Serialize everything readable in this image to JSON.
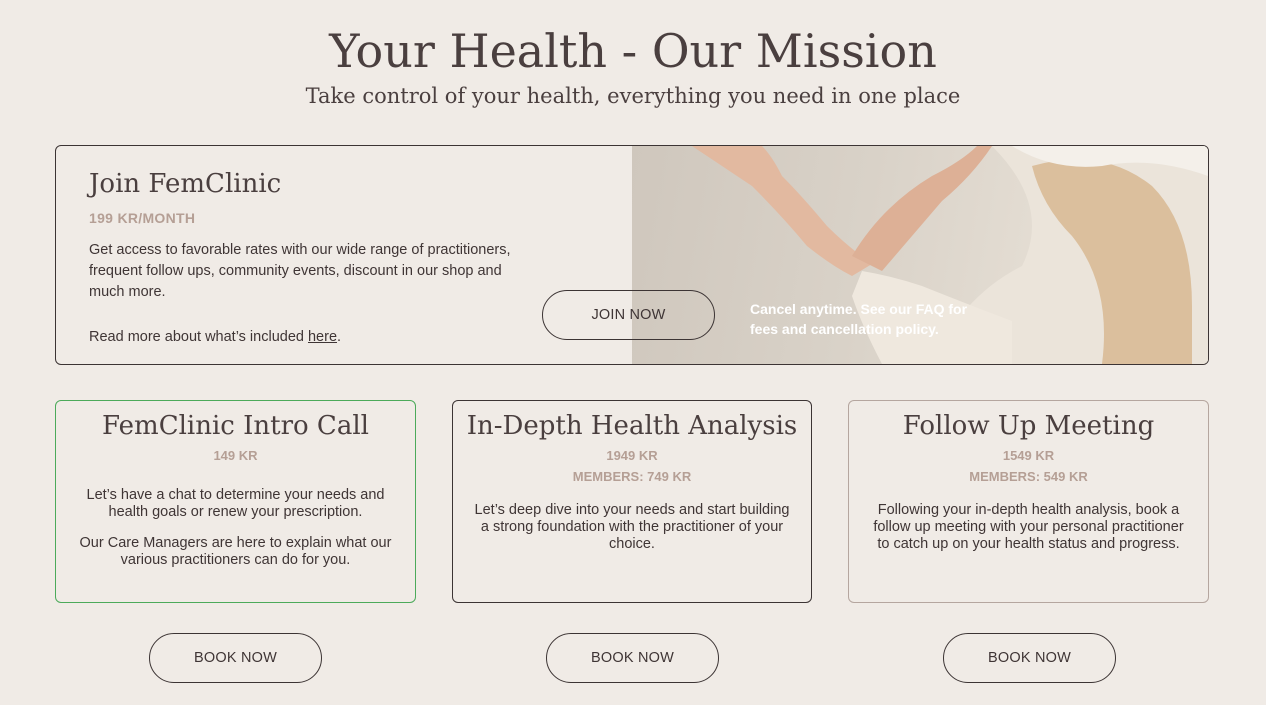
{
  "hero": {
    "title": "Your Health - Our Mission",
    "subtitle": "Take control of your health, everything you need in one place"
  },
  "membership": {
    "title": "Join FemClinic",
    "price": "199 KR/MONTH",
    "description": "Get access to favorable rates with our wide range of practitioners, frequent follow ups, community events, discount in our shop and much more.",
    "read_more_prefix": "Read more about what’s included ",
    "read_more_link": "here",
    "read_more_suffix": ".",
    "join_label": "JOIN NOW",
    "cancel_note": "Cancel anytime. See our FAQ for fees and cancellation policy."
  },
  "services": [
    {
      "title": "FemClinic Intro Call",
      "price": "149 KR",
      "description": "Let’s have a chat to determine your needs and health goals or renew your prescription.",
      "description_2": "Our Care Managers are here to explain what our various practitioners can do for you.",
      "button": "BOOK NOW"
    },
    {
      "title": "In-Depth Health Analysis",
      "price": "1949 KR",
      "member_price": "MEMBERS: 749 KR",
      "description": "Let’s deep dive into your needs and start building a strong foundation with the practitioner of your choice.",
      "button": "BOOK NOW"
    },
    {
      "title": "Follow Up Meeting",
      "price": "1549 KR",
      "member_price": "MEMBERS: 549 KR",
      "description": "Following your in-depth health analysis, book a follow up meeting with your personal practitioner to catch up on your health status and progress.",
      "button": "BOOK NOW"
    }
  ],
  "colors": {
    "background": "#f0ebe6",
    "text": "#4a3f3f",
    "accent_price": "#b59f95",
    "intro_card_border": "#4caa5a"
  }
}
